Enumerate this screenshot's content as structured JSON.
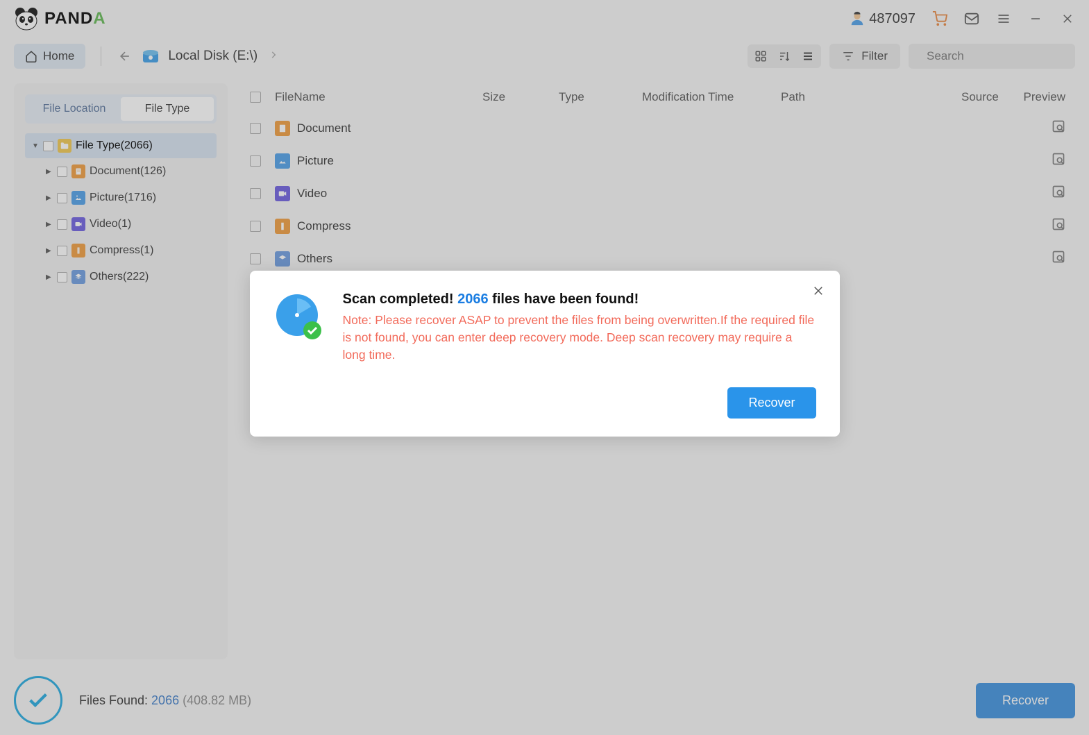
{
  "app": {
    "name_part1": "PAND",
    "name_part2": "A"
  },
  "titlebar": {
    "user_id": "487097"
  },
  "toolbar": {
    "home": "Home",
    "breadcrumb": "Local Disk (E:\\)",
    "filter": "Filter",
    "search_placeholder": "Search"
  },
  "sidebar": {
    "tabs": {
      "location": "File Location",
      "type": "File Type"
    },
    "root": {
      "label": "File Type",
      "count": "(2066)"
    },
    "items": [
      {
        "label": "Document",
        "count": "(126)"
      },
      {
        "label": "Picture",
        "count": "(1716)"
      },
      {
        "label": "Video",
        "count": "(1)"
      },
      {
        "label": "Compress",
        "count": "(1)"
      },
      {
        "label": "Others",
        "count": "(222)"
      }
    ]
  },
  "columns": {
    "name": "FileName",
    "size": "Size",
    "type": "Type",
    "mod": "Modification Time",
    "path": "Path",
    "source": "Source",
    "preview": "Preview"
  },
  "rows": [
    {
      "label": "Document"
    },
    {
      "label": "Picture"
    },
    {
      "label": "Video"
    },
    {
      "label": "Compress"
    },
    {
      "label": "Others"
    }
  ],
  "footer": {
    "label": "Files Found:  ",
    "count": "2066",
    "size": " (408.82 MB)",
    "recover": "Recover"
  },
  "modal": {
    "title_pre": "Scan completed! ",
    "title_count": "2066",
    "title_post": " files have been found!",
    "note": "Note: Please recover ASAP to prevent the files from being overwritten.If the required file is not found, you can enter deep recovery mode. Deep scan recovery may require a long time.",
    "recover": "Recover"
  }
}
